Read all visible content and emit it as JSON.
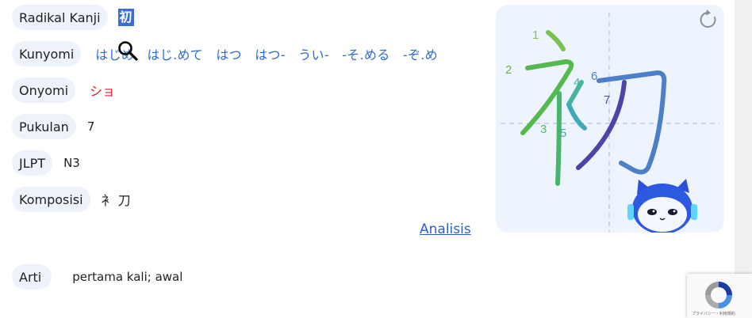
{
  "rows": {
    "radical": {
      "label": "Radikal Kanji",
      "value": "初"
    },
    "kunyomi": {
      "label": "Kunyomi",
      "value": "はじめ　はじ.めて　はつ　はつ-　うい-　-そ.める　-ぞ.め"
    },
    "onyomi": {
      "label": "Onyomi",
      "value": "ショ"
    },
    "strokes": {
      "label": "Pukulan",
      "value": "7"
    },
    "jlpt": {
      "label": "JLPT",
      "value": "N3"
    },
    "composition": {
      "label": "Komposisi",
      "value": "衤 刀"
    },
    "meaning": {
      "label": "Arti",
      "value": "pertama kali; awal"
    }
  },
  "analysis_link": "Analisis",
  "stroke_panel": {
    "stroke_numbers": [
      "1",
      "2",
      "3",
      "4",
      "5",
      "6",
      "7"
    ],
    "replay_icon": "refresh-icon",
    "mascot_icon": "robot-cat-mascot"
  },
  "recaptcha": {
    "footer": "プライバシー・利用規約"
  },
  "colors": {
    "kunyomi": "#2d6ad3",
    "onyomi": "#d0202a",
    "pill_bg": "#eef3fb",
    "panel_bg": "#eef4fd",
    "highlight": "#3b6fd6"
  }
}
